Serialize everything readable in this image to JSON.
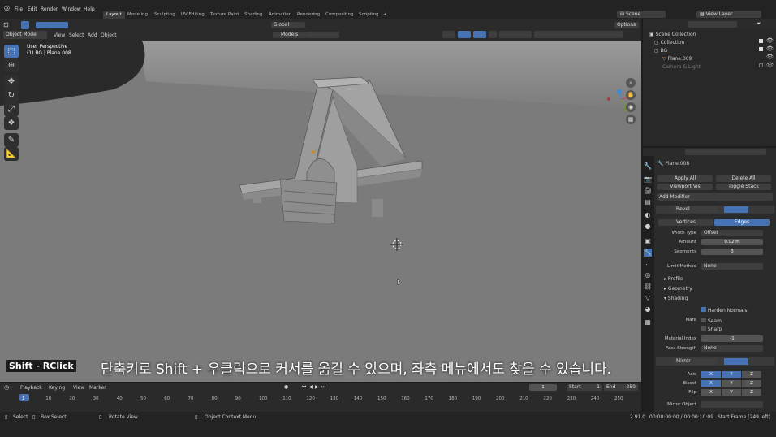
{
  "topbar": {
    "menus": [
      "File",
      "Edit",
      "Render",
      "Window",
      "Help"
    ],
    "tabs": [
      "Layout",
      "Modeling",
      "Sculpting",
      "UV Editing",
      "Texture Paint",
      "Shading",
      "Animation",
      "Rendering",
      "Compositing",
      "Scripting"
    ],
    "add": "+",
    "scene": "Scene",
    "view_layer": "View Layer"
  },
  "viewport": {
    "mode": "Object Mode",
    "menus": [
      "View",
      "Select",
      "Add",
      "Object"
    ],
    "orientation": "Global",
    "pivot": "Models",
    "options": "Options",
    "perspective": "User Perspective",
    "object_info": "(1) BG | Plane.008"
  },
  "outliner": {
    "root": "Scene Collection",
    "items": [
      "Collection",
      "BG",
      "Plane.009",
      "Camera & Light"
    ]
  },
  "properties": {
    "object": "Plane.008",
    "apply_all": "Apply All",
    "delete_all": "Delete All",
    "viewport_vis": "Viewport Vis",
    "toggle_stack": "Toggle Stack",
    "add_modifier": "Add Modifier",
    "bevel": {
      "name": "Bevel",
      "tab_vertices": "Vertices",
      "tab_edges": "Edges",
      "width_type_label": "Width Type",
      "width_type": "Offset",
      "amount_label": "Amount",
      "amount": "0.02 m",
      "segments_label": "Segments",
      "segments": "3",
      "limit_label": "Limit Method",
      "limit": "None",
      "profile": "Profile",
      "geometry": "Geometry",
      "shading": "Shading",
      "harden": "Harden Normals",
      "mark_label": "Mark",
      "seam": "Seam",
      "sharp": "Sharp",
      "matidx_label": "Material Index",
      "matidx": "-1",
      "face_label": "Face Strength",
      "face": "None"
    },
    "mirror": {
      "name": "Mirror",
      "axis_label": "Axis",
      "bisect_label": "Bisect",
      "flip_label": "Flip",
      "x": "X",
      "y": "Y",
      "z": "Z",
      "mirror_object": "Mirror Object"
    }
  },
  "timeline": {
    "menus": [
      "Playback",
      "Keying",
      "View",
      "Marker"
    ],
    "frame": "1",
    "start_label": "Start",
    "start": "1",
    "end_label": "End",
    "end": "250",
    "ticks": [
      "1",
      "10",
      "20",
      "30",
      "40",
      "50",
      "60",
      "70",
      "80",
      "90",
      "100",
      "110",
      "120",
      "130",
      "140",
      "150",
      "160",
      "170",
      "180",
      "190",
      "200",
      "210",
      "220",
      "230",
      "240",
      "250"
    ]
  },
  "statusbar": {
    "select": "Select",
    "box_select": "Box Select",
    "rotate": "Rotate View",
    "context": "Object Context Menu",
    "version": "2.91.0",
    "time": "00:00:00:00 / 00:00:10:09",
    "start_frame": "Start Frame (249 left)"
  },
  "overlay": {
    "shortcut": "Shift - RClick",
    "subtitle": "단축키로 Shift + 우클릭으로 커서를 옮길 수 있으며, 좌측 메뉴에서도 찾을 수 있습니다."
  },
  "colors": {
    "accent": "#4772b3",
    "viewport_bg": "#7a7a7a"
  }
}
